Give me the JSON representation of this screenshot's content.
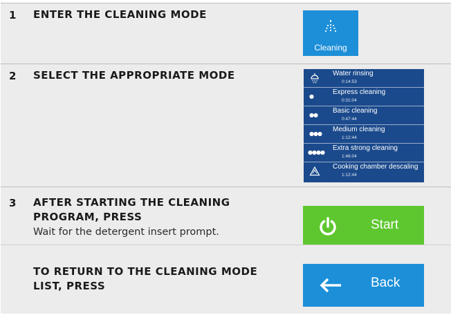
{
  "steps": [
    {
      "number": "1",
      "title": "ENTER THE CLEANING MODE",
      "tile_label": "Cleaning",
      "tile_icon": "shower-icon"
    },
    {
      "number": "2",
      "title": "SELECT THE APPROPRIATE MODE"
    },
    {
      "number": "3",
      "title_line1": "AFTER STARTING THE CLEANING",
      "title_line2": "PROGRAM, PRESS",
      "description": "Wait for the detergent insert prompt.",
      "button_label": "Start",
      "button_icon": "power-icon"
    },
    {
      "title_line1": "TO RETURN TO THE CLEANING MODE",
      "title_line2": "LIST, PRESS",
      "button_label": "Back",
      "button_icon": "arrow-left-icon"
    }
  ],
  "modes": [
    {
      "icon": "shower-icon",
      "name": "Water rinsing",
      "time": "0:14:53"
    },
    {
      "icon": "one-drop-icon",
      "name": "Express cleaning",
      "time": "0:31:04"
    },
    {
      "icon": "two-drops-icon",
      "name": "Basic cleaning",
      "time": "0:47:44"
    },
    {
      "icon": "three-drops-icon",
      "name": "Medium cleaning",
      "time": "1:12:44"
    },
    {
      "icon": "four-drops-icon",
      "name": "Extra strong cleaning",
      "time": "1:46:04"
    },
    {
      "icon": "descaling-icon",
      "name": "Cooking chamber descaling",
      "time": "1:12:44"
    }
  ],
  "colors": {
    "panel_background": "#ececec",
    "tile_blue": "#1d8fd8",
    "list_navy": "#1b4a8c",
    "start_green": "#5ec72f"
  }
}
